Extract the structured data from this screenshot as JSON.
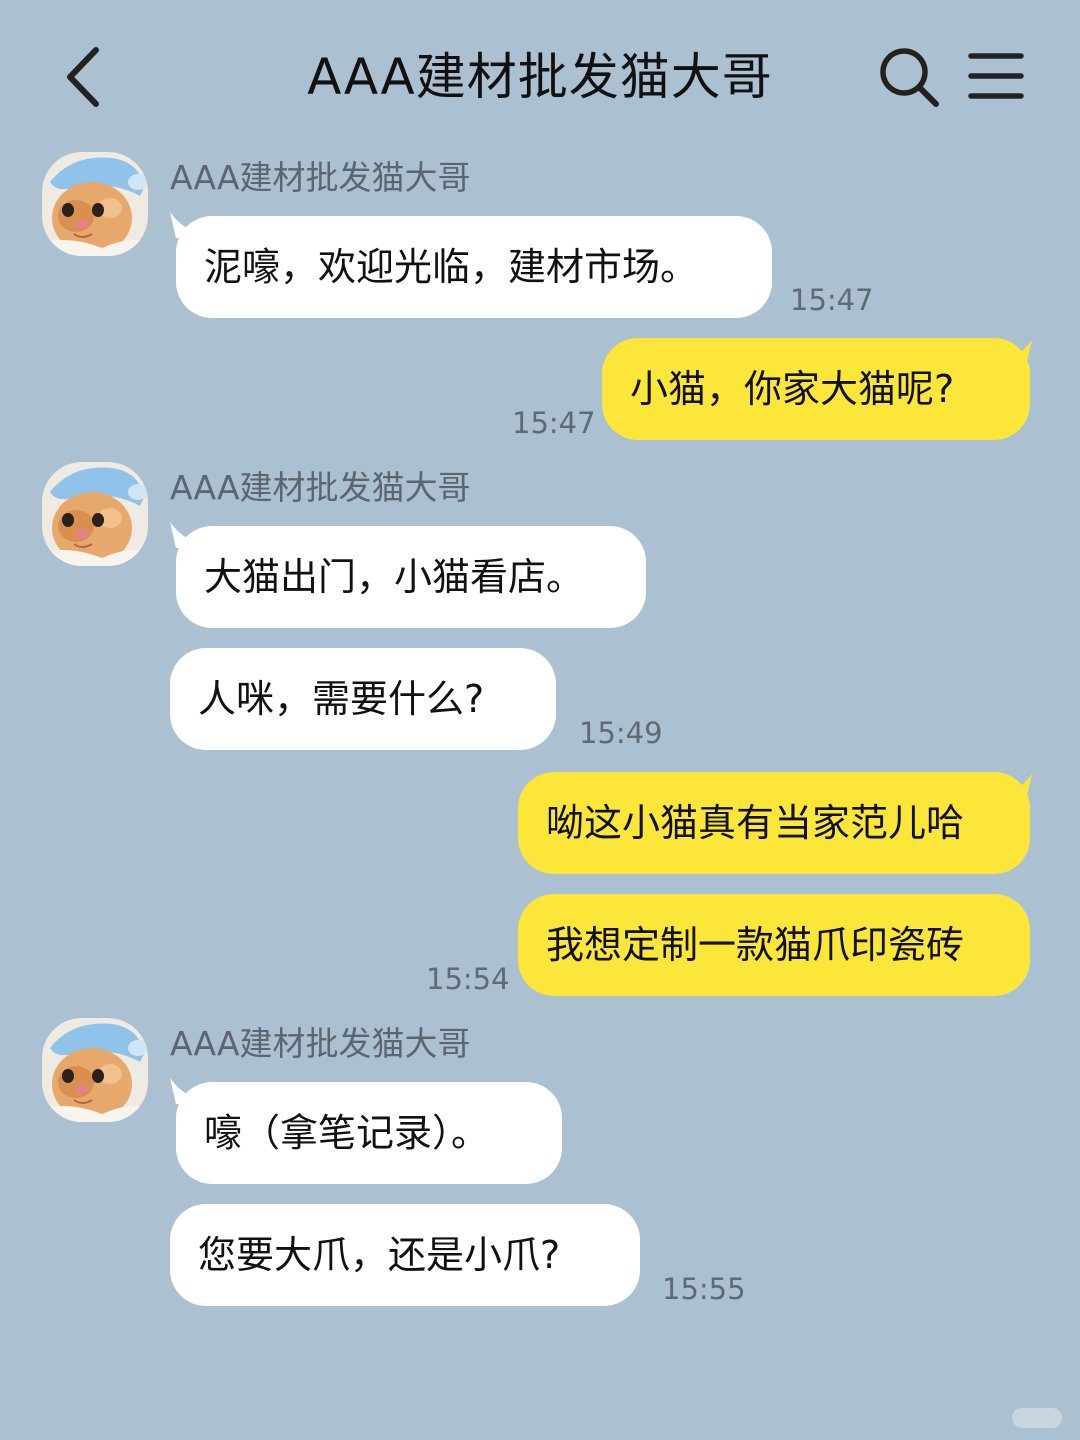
{
  "header": {
    "title": "AAA建材批发猫大哥",
    "back_icon": "chevron-left-icon",
    "search_icon": "search-icon",
    "menu_icon": "hamburger-menu-icon"
  },
  "contact": {
    "name": "AAA建材批发猫大哥",
    "avatar": "kitten-with-blue-cap"
  },
  "colors": {
    "background": "#abc1d1",
    "incoming_bubble": "#ffffff",
    "outgoing_bubble": "#fde63a"
  },
  "messages": [
    {
      "sender_label": "AAA建材批发猫大哥",
      "text": "泥嚎，欢迎光临，建材市场。",
      "time": "15:47"
    },
    {
      "text": "小猫，你家大猫呢?",
      "time": "15:47"
    },
    {
      "sender_label": "AAA建材批发猫大哥",
      "text": "大猫出门，小猫看店。"
    },
    {
      "text": "人咪，需要什么?",
      "time": "15:49"
    },
    {
      "text": "呦这小猫真有当家范儿哈"
    },
    {
      "text": "我想定制一款猫爪印瓷砖",
      "time": "15:54"
    },
    {
      "sender_label": "AAA建材批发猫大哥",
      "text": "嚎（拿笔记录）。"
    },
    {
      "text": "您要大爪，还是小爪?",
      "time": "15:55"
    }
  ]
}
